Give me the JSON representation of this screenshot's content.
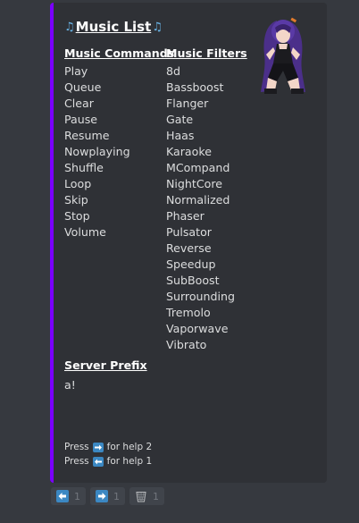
{
  "embed": {
    "accent_color": "#7b00ff",
    "title": "Music List",
    "title_icons": [
      "music-notes-icon",
      "music-notes-icon"
    ],
    "commands": {
      "heading": "Music Commands",
      "items": [
        "Play",
        "Queue",
        "Clear",
        "Pause",
        "Resume",
        "Nowplaying",
        "Shuffle",
        "Loop",
        "Skip",
        "Stop",
        "Volume"
      ]
    },
    "filters": {
      "heading": "Music Filters",
      "items": [
        "8d",
        "Bassboost",
        "Flanger",
        "Gate",
        "Haas",
        "Karaoke",
        "MCompand",
        "NightCore",
        "Normalized",
        "Phaser",
        "Pulsator",
        "Reverse",
        "Speedup",
        "SubBoost",
        "Surrounding",
        "Tremolo",
        "Vaporwave",
        "Vibrato"
      ]
    },
    "server_prefix": {
      "heading": "Server Prefix",
      "value": "a!"
    },
    "help": [
      {
        "pre": "Press",
        "icon": "right-arrow-key-icon",
        "post": "for help 2"
      },
      {
        "pre": "Press",
        "icon": "left-arrow-key-icon",
        "post": "for help 1"
      }
    ]
  },
  "reactions": [
    {
      "icon": "left-arrow-icon",
      "count": "1"
    },
    {
      "icon": "right-arrow-icon",
      "count": "1"
    },
    {
      "icon": "wastebasket-icon",
      "count": "1"
    }
  ]
}
